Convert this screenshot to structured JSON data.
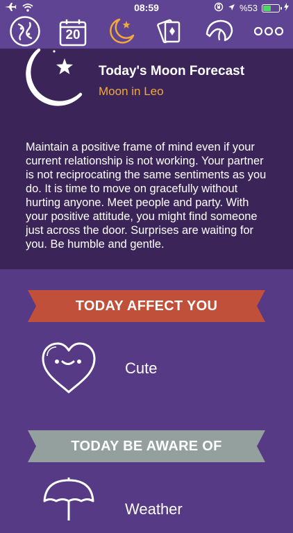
{
  "status_bar": {
    "time": "08:59",
    "battery": "%53",
    "battery_level": 0.53,
    "battery_color": "#4cd964",
    "icons": [
      "airplane-icon",
      "wifi-icon",
      "lock-rotation-icon",
      "location-arrow-icon",
      "battery-icon",
      "charging-bolt-icon"
    ]
  },
  "nav": {
    "items": [
      {
        "icon": "pisces-icon"
      },
      {
        "icon": "calendar-icon",
        "text": "20"
      },
      {
        "icon": "moon-star-icon",
        "active": true
      },
      {
        "icon": "tarot-card-icon"
      },
      {
        "icon": "fortune-cookie-icon"
      },
      {
        "icon": "more-icon"
      }
    ],
    "active_color": "#f2a93b"
  },
  "forecast": {
    "icon": "moon-star-icon",
    "title": "Today's Moon Forecast",
    "subtitle": "Moon in Leo",
    "body": "Maintain a positive frame of mind even if your current relationship is not working. Your partner is not reciprocating the same sentiments as you do. It is time to move on gracefully without hurting anyone. Meet people and party. With your positive attitude, you might find someone just across the door. Surprises are waiting for you. Be humble and gentle."
  },
  "sections": [
    {
      "header": "TODAY AFFECT YOU",
      "ribbon_color": "#c0503a",
      "icon": "heart-face-icon",
      "label": "Cute"
    },
    {
      "header": "TODAY BE AWARE OF",
      "ribbon_color": "#94a09d",
      "icon": "umbrella-icon",
      "label": "Weather"
    }
  ],
  "colors": {
    "background": "#573a86",
    "panel": "#3b2558",
    "bar": "#5e4493"
  }
}
